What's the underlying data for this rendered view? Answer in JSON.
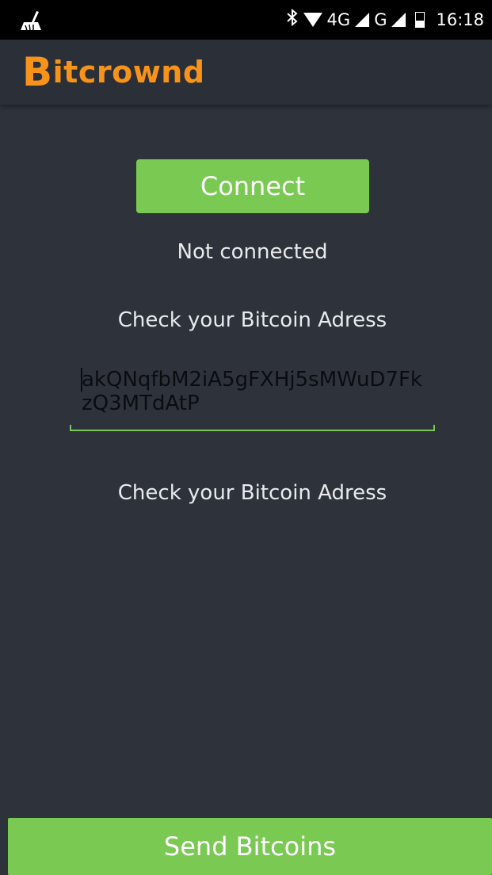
{
  "status_bar": {
    "time": "16:18",
    "network_1": "4G",
    "network_2": "G",
    "icons": [
      "cleaner-icon",
      "bluetooth-icon",
      "wifi-icon",
      "signal-icon",
      "signal-icon",
      "battery-icon"
    ]
  },
  "app": {
    "logo_letter": "B",
    "logo_rest": "itcrownd",
    "brand_color": "#f7931a"
  },
  "main": {
    "connect_label": "Connect",
    "connection_status": "Not connected",
    "check_label_top": "Check your Bitcoin Adress",
    "address_value": "akQNqfbM2iA5gFXHj5sMWuD7FkzQ3MTdAtP",
    "check_label_bottom": "Check your Bitcoin Adress"
  },
  "footer": {
    "send_label": "Send Bitcoins"
  },
  "colors": {
    "accent": "#7ac953",
    "background": "#2e333b",
    "status_bar": "#000000"
  }
}
